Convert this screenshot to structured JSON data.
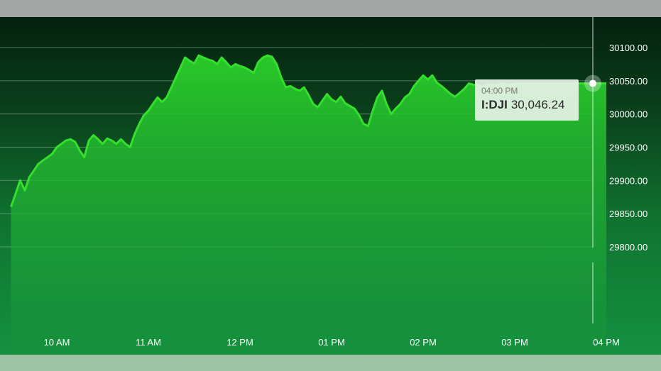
{
  "colors": {
    "line": "#33e02c",
    "area_top": "#2bd12a",
    "area_bottom": "#15903c",
    "gridline": "#8fb89a",
    "cursor": "#ffffff"
  },
  "tooltip": {
    "time": "04:00 PM",
    "symbol": "I:DJI",
    "value": "30,046.24"
  },
  "chart_data": {
    "type": "area",
    "title": "",
    "xlabel": "",
    "ylabel": "",
    "ylim": [
      29750,
      30125
    ],
    "xlim": [
      "09:30",
      "16:00"
    ],
    "grid": true,
    "x_ticks": [
      "10 AM",
      "11 AM",
      "12 PM",
      "01 PM",
      "02 PM",
      "03 PM",
      "04 PM"
    ],
    "x_tick_times": [
      "10:00",
      "11:00",
      "12:00",
      "13:00",
      "14:00",
      "15:00",
      "16:00"
    ],
    "y_ticks": [
      "30100.00",
      "30050.00",
      "30000.00",
      "29950.00",
      "29900.00",
      "29850.00",
      "29800.00"
    ],
    "y_tick_values": [
      30100,
      30050,
      30000,
      29950,
      29900,
      29850,
      29800
    ],
    "series": [
      {
        "x": [
          "09:30",
          "09:33",
          "09:36",
          "09:39",
          "09:42",
          "09:45",
          "09:48",
          "09:51",
          "09:54",
          "09:57",
          "10:00",
          "10:03",
          "10:06",
          "10:09",
          "10:12",
          "10:15",
          "10:18",
          "10:21",
          "10:24",
          "10:27",
          "10:30",
          "10:33",
          "10:36",
          "10:39",
          "10:42",
          "10:45",
          "10:48",
          "10:51",
          "10:54",
          "10:57",
          "11:00",
          "11:03",
          "11:06",
          "11:09",
          "11:12",
          "11:15",
          "11:18",
          "11:21",
          "11:24",
          "11:27",
          "11:30",
          "11:33",
          "11:36",
          "11:39",
          "11:42",
          "11:45",
          "11:48",
          "11:51",
          "11:54",
          "11:57",
          "12:00",
          "12:03",
          "12:06",
          "12:09",
          "12:12",
          "12:15",
          "12:18",
          "12:21",
          "12:24",
          "12:27",
          "12:30",
          "12:33",
          "12:36",
          "12:39",
          "12:42",
          "12:45",
          "12:48",
          "12:51",
          "12:54",
          "12:57",
          "13:00",
          "13:03",
          "13:06",
          "13:09",
          "13:12",
          "13:15",
          "13:18",
          "13:21",
          "13:24",
          "13:27",
          "13:30",
          "13:33",
          "13:36",
          "13:39",
          "13:42",
          "13:45",
          "13:48",
          "13:51",
          "13:54",
          "13:57",
          "14:00",
          "14:03",
          "14:06",
          "14:09",
          "14:12",
          "14:15",
          "14:18",
          "14:21",
          "14:24",
          "14:27",
          "14:30",
          "14:33",
          "14:36",
          "14:39",
          "14:42",
          "14:45",
          "14:48",
          "14:51",
          "14:54",
          "14:57",
          "15:00",
          "15:03",
          "15:06",
          "15:09",
          "15:12",
          "15:15",
          "15:18",
          "15:21",
          "15:24",
          "15:27",
          "15:30",
          "15:33",
          "15:36",
          "15:39",
          "15:42",
          "15:45",
          "15:48",
          "15:51",
          "15:54",
          "15:57",
          "16:00"
        ],
        "y": [
          29860,
          29880,
          29900,
          29885,
          29905,
          29915,
          29925,
          29930,
          29935,
          29940,
          29950,
          29955,
          29960,
          29962,
          29958,
          29945,
          29935,
          29960,
          29968,
          29962,
          29955,
          29963,
          29960,
          29955,
          29962,
          29955,
          29950,
          29970,
          29985,
          29998,
          30005,
          30015,
          30025,
          30018,
          30025,
          30040,
          30055,
          30070,
          30085,
          30080,
          30076,
          30088,
          30085,
          30082,
          30080,
          30075,
          30085,
          30078,
          30070,
          30075,
          30072,
          30070,
          30066,
          30062,
          30078,
          30085,
          30088,
          30086,
          30075,
          30055,
          30040,
          30042,
          30038,
          30035,
          30040,
          30028,
          30015,
          30010,
          30020,
          30030,
          30022,
          30018,
          30026,
          30016,
          30012,
          30008,
          29998,
          29985,
          29982,
          30005,
          30025,
          30035,
          30015,
          30000,
          30008,
          30015,
          30025,
          30030,
          30042,
          30050,
          30058,
          30052,
          30058,
          30047,
          30042,
          30036,
          30030,
          30026,
          30032,
          30038,
          30046,
          30044,
          30043,
          30041,
          30045,
          30044,
          30043,
          30046,
          30045,
          30044,
          30046,
          30046,
          30046,
          30046,
          30046,
          30046,
          30046,
          30046,
          30046,
          30046,
          30046,
          30046,
          30046,
          30046,
          30046,
          30046,
          30046,
          30046,
          30046,
          30046,
          30046
        ]
      }
    ]
  }
}
